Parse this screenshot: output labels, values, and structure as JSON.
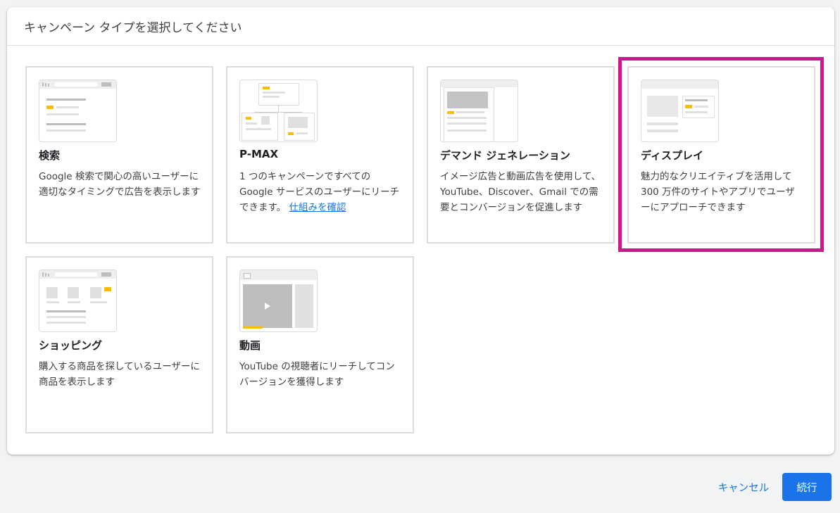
{
  "dialog": {
    "title": "キャンペーン タイプを選択してください"
  },
  "cards": [
    {
      "title": "検索",
      "desc": "Google 検索で関心の高いユーザーに適切なタイミングで広告を表示します"
    },
    {
      "title": "P-MAX",
      "desc": "1 つのキャンペーンですべての Google サービスのユーザーにリーチできます。",
      "link": "仕組みを確認"
    },
    {
      "title": "デマンド ジェネレーション",
      "desc": "イメージ広告と動画広告を使用して、YouTube、Discover、Gmail での需要とコンバージョンを促進します"
    },
    {
      "title": "ディスプレイ",
      "desc": "魅力的なクリエイティブを活用して 300 万件のサイトやアプリでユーザーにアプローチできます"
    },
    {
      "title": "ショッピング",
      "desc": "購入する商品を探しているユーザーに商品を表示します"
    },
    {
      "title": "動画",
      "desc": "YouTube の視聴者にリーチしてコンバージョンを獲得します"
    }
  ],
  "footer": {
    "cancel_label": "キャンセル",
    "continue_label": "続行"
  },
  "colors": {
    "accent": "#1a73e8",
    "highlight": "#d4148a",
    "thumb_yellow": "#fbbc04"
  }
}
